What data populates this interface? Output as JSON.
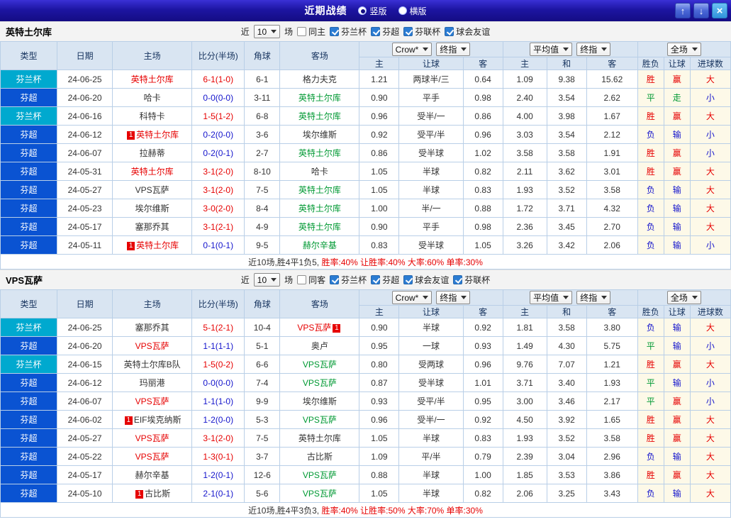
{
  "palette": {
    "cup_bg": "#00a9cf",
    "league_bg": "#0a53d2",
    "red": "#e60000",
    "green": "#009933",
    "blue": "#1414cc",
    "black": "#333333",
    "header_bg": "#d9e5f2",
    "result_bg": "#fdf9e8",
    "topbar_bg": "#1d15a2"
  },
  "topbar": {
    "title": "近期战绩",
    "vertical_label": "竖版",
    "horizontal_label": "横版",
    "up_icon": "↑",
    "down_icon": "↓",
    "close_icon": "×"
  },
  "columns": {
    "type": "类型",
    "date": "日期",
    "home": "主场",
    "score": "比分(半场)",
    "corner": "角球",
    "away": "客场",
    "asia_bookmaker": "Crow*",
    "asia_stage": "终指",
    "asia_home": "主",
    "asia_handicap": "让球",
    "asia_away": "客",
    "euro_avg": "平均值",
    "euro_stage": "终指",
    "euro_home": "主",
    "euro_draw": "和",
    "euro_away": "客",
    "result_scope": "全场",
    "result_wdl": "胜负",
    "result_handicap": "让球",
    "result_goals": "进球数"
  },
  "sections": [
    {
      "team": "英特土尔库",
      "filter": {
        "near_label": "近",
        "match_count": "10",
        "games_label": "场",
        "same_label": "同主",
        "same_checked": false,
        "leagues": [
          {
            "label": "芬兰杯",
            "checked": true
          },
          {
            "label": "芬超",
            "checked": true
          },
          {
            "label": "芬联杯",
            "checked": true
          },
          {
            "label": "球会友谊",
            "checked": true
          }
        ]
      },
      "summary_prefix": "近10场,胜4平1负5,",
      "summary_stats": "胜率:40% 让胜率:40% 大率:60% 单率:30%",
      "rows": [
        {
          "league": "芬兰杯",
          "cup": true,
          "date": "24-06-25",
          "home": {
            "name": "英特土尔库",
            "color": "red"
          },
          "score": {
            "text": "6-1(1-0)",
            "color": "red"
          },
          "corner": "6-1",
          "away": {
            "name": "格力夫克",
            "color": "black"
          },
          "asia": [
            "1.21",
            "两球半/三",
            "0.64"
          ],
          "euro": [
            "1.09",
            "9.38",
            "15.62"
          ],
          "result": [
            [
              "胜",
              "red"
            ],
            [
              "赢",
              "red"
            ],
            [
              "大",
              "red"
            ]
          ]
        },
        {
          "league": "芬超",
          "cup": false,
          "date": "24-06-20",
          "home": {
            "name": "哈卡",
            "color": "black"
          },
          "score": {
            "text": "0-0(0-0)",
            "color": "blue"
          },
          "corner": "3-11",
          "away": {
            "name": "英特土尔库",
            "color": "green"
          },
          "asia": [
            "0.90",
            "平手",
            "0.98"
          ],
          "euro": [
            "2.40",
            "3.54",
            "2.62"
          ],
          "result": [
            [
              "平",
              "green"
            ],
            [
              "走",
              "green"
            ],
            [
              "小",
              "blue"
            ]
          ]
        },
        {
          "league": "芬兰杯",
          "cup": true,
          "date": "24-06-16",
          "home": {
            "name": "科特卡",
            "color": "black"
          },
          "score": {
            "text": "1-5(1-2)",
            "color": "red"
          },
          "corner": "6-8",
          "away": {
            "name": "英特土尔库",
            "color": "green"
          },
          "asia": [
            "0.96",
            "受半/一",
            "0.86"
          ],
          "euro": [
            "4.00",
            "3.98",
            "1.67"
          ],
          "result": [
            [
              "胜",
              "red"
            ],
            [
              "赢",
              "red"
            ],
            [
              "大",
              "red"
            ]
          ]
        },
        {
          "league": "芬超",
          "cup": false,
          "date": "24-06-12",
          "home": {
            "name": "英特土尔库",
            "color": "red",
            "badge": "1"
          },
          "score": {
            "text": "0-2(0-0)",
            "color": "blue"
          },
          "corner": "3-6",
          "away": {
            "name": "埃尔维斯",
            "color": "black"
          },
          "asia": [
            "0.92",
            "受平/半",
            "0.96"
          ],
          "euro": [
            "3.03",
            "3.54",
            "2.12"
          ],
          "result": [
            [
              "负",
              "blue"
            ],
            [
              "输",
              "blue"
            ],
            [
              "小",
              "blue"
            ]
          ]
        },
        {
          "league": "芬超",
          "cup": false,
          "date": "24-06-07",
          "home": {
            "name": "拉赫蒂",
            "color": "black"
          },
          "score": {
            "text": "0-2(0-1)",
            "color": "blue"
          },
          "corner": "2-7",
          "away": {
            "name": "英特土尔库",
            "color": "green"
          },
          "asia": [
            "0.86",
            "受半球",
            "1.02"
          ],
          "euro": [
            "3.58",
            "3.58",
            "1.91"
          ],
          "result": [
            [
              "胜",
              "red"
            ],
            [
              "赢",
              "red"
            ],
            [
              "小",
              "blue"
            ]
          ]
        },
        {
          "league": "芬超",
          "cup": false,
          "date": "24-05-31",
          "home": {
            "name": "英特土尔库",
            "color": "red"
          },
          "score": {
            "text": "3-1(2-0)",
            "color": "red"
          },
          "corner": "8-10",
          "away": {
            "name": "哈卡",
            "color": "black"
          },
          "asia": [
            "1.05",
            "半球",
            "0.82"
          ],
          "euro": [
            "2.11",
            "3.62",
            "3.01"
          ],
          "result": [
            [
              "胜",
              "red"
            ],
            [
              "赢",
              "red"
            ],
            [
              "大",
              "red"
            ]
          ]
        },
        {
          "league": "芬超",
          "cup": false,
          "date": "24-05-27",
          "home": {
            "name": "VPS瓦萨",
            "color": "black"
          },
          "score": {
            "text": "3-1(2-0)",
            "color": "red"
          },
          "corner": "7-5",
          "away": {
            "name": "英特土尔库",
            "color": "green"
          },
          "asia": [
            "1.05",
            "半球",
            "0.83"
          ],
          "euro": [
            "1.93",
            "3.52",
            "3.58"
          ],
          "result": [
            [
              "负",
              "blue"
            ],
            [
              "输",
              "blue"
            ],
            [
              "大",
              "red"
            ]
          ]
        },
        {
          "league": "芬超",
          "cup": false,
          "date": "24-05-23",
          "home": {
            "name": "埃尔维斯",
            "color": "black"
          },
          "score": {
            "text": "3-0(2-0)",
            "color": "red"
          },
          "corner": "8-4",
          "away": {
            "name": "英特土尔库",
            "color": "green"
          },
          "asia": [
            "1.00",
            "半/一",
            "0.88"
          ],
          "euro": [
            "1.72",
            "3.71",
            "4.32"
          ],
          "result": [
            [
              "负",
              "blue"
            ],
            [
              "输",
              "blue"
            ],
            [
              "大",
              "red"
            ]
          ]
        },
        {
          "league": "芬超",
          "cup": false,
          "date": "24-05-17",
          "home": {
            "name": "塞那乔其",
            "color": "black"
          },
          "score": {
            "text": "3-1(2-1)",
            "color": "red"
          },
          "corner": "4-9",
          "away": {
            "name": "英特土尔库",
            "color": "green"
          },
          "asia": [
            "0.90",
            "平手",
            "0.98"
          ],
          "euro": [
            "2.36",
            "3.45",
            "2.70"
          ],
          "result": [
            [
              "负",
              "blue"
            ],
            [
              "输",
              "blue"
            ],
            [
              "大",
              "red"
            ]
          ]
        },
        {
          "league": "芬超",
          "cup": false,
          "date": "24-05-11",
          "home": {
            "name": "英特土尔库",
            "color": "red",
            "badge": "1"
          },
          "score": {
            "text": "0-1(0-1)",
            "color": "blue"
          },
          "corner": "9-5",
          "away": {
            "name": "赫尔辛基",
            "color": "green"
          },
          "asia": [
            "0.83",
            "受半球",
            "1.05"
          ],
          "euro": [
            "3.26",
            "3.42",
            "2.06"
          ],
          "result": [
            [
              "负",
              "blue"
            ],
            [
              "输",
              "blue"
            ],
            [
              "小",
              "blue"
            ]
          ]
        }
      ]
    },
    {
      "team": "VPS瓦萨",
      "filter": {
        "near_label": "近",
        "match_count": "10",
        "games_label": "场",
        "same_label": "同客",
        "same_checked": false,
        "leagues": [
          {
            "label": "芬兰杯",
            "checked": true
          },
          {
            "label": "芬超",
            "checked": true
          },
          {
            "label": "球会友谊",
            "checked": true
          },
          {
            "label": "芬联杯",
            "checked": true
          }
        ]
      },
      "summary_prefix": "近10场,胜4平3负3,",
      "summary_stats": "胜率:40% 让胜率:50% 大率:70% 单率:30%",
      "rows": [
        {
          "league": "芬兰杯",
          "cup": true,
          "date": "24-06-25",
          "home": {
            "name": "塞那乔其",
            "color": "black"
          },
          "score": {
            "text": "5-1(2-1)",
            "color": "red"
          },
          "corner": "10-4",
          "away": {
            "name": "VPS瓦萨",
            "color": "red",
            "badge": "1"
          },
          "asia": [
            "0.90",
            "半球",
            "0.92"
          ],
          "euro": [
            "1.81",
            "3.58",
            "3.80"
          ],
          "result": [
            [
              "负",
              "blue"
            ],
            [
              "输",
              "blue"
            ],
            [
              "大",
              "red"
            ]
          ]
        },
        {
          "league": "芬超",
          "cup": false,
          "date": "24-06-20",
          "home": {
            "name": "VPS瓦萨",
            "color": "red"
          },
          "score": {
            "text": "1-1(1-1)",
            "color": "blue"
          },
          "corner": "5-1",
          "away": {
            "name": "奥卢",
            "color": "black"
          },
          "asia": [
            "0.95",
            "一球",
            "0.93"
          ],
          "euro": [
            "1.49",
            "4.30",
            "5.75"
          ],
          "result": [
            [
              "平",
              "green"
            ],
            [
              "输",
              "blue"
            ],
            [
              "小",
              "blue"
            ]
          ]
        },
        {
          "league": "芬兰杯",
          "cup": true,
          "date": "24-06-15",
          "home": {
            "name": "英特土尔库B队",
            "color": "black"
          },
          "score": {
            "text": "1-5(0-2)",
            "color": "red"
          },
          "corner": "6-6",
          "away": {
            "name": "VPS瓦萨",
            "color": "green"
          },
          "asia": [
            "0.80",
            "受两球",
            "0.96"
          ],
          "euro": [
            "9.76",
            "7.07",
            "1.21"
          ],
          "result": [
            [
              "胜",
              "red"
            ],
            [
              "赢",
              "red"
            ],
            [
              "大",
              "red"
            ]
          ]
        },
        {
          "league": "芬超",
          "cup": false,
          "date": "24-06-12",
          "home": {
            "name": "玛丽港",
            "color": "black"
          },
          "score": {
            "text": "0-0(0-0)",
            "color": "blue"
          },
          "corner": "7-4",
          "away": {
            "name": "VPS瓦萨",
            "color": "green"
          },
          "asia": [
            "0.87",
            "受半球",
            "1.01"
          ],
          "euro": [
            "3.71",
            "3.40",
            "1.93"
          ],
          "result": [
            [
              "平",
              "green"
            ],
            [
              "输",
              "blue"
            ],
            [
              "小",
              "blue"
            ]
          ]
        },
        {
          "league": "芬超",
          "cup": false,
          "date": "24-06-07",
          "home": {
            "name": "VPS瓦萨",
            "color": "red"
          },
          "score": {
            "text": "1-1(1-0)",
            "color": "blue"
          },
          "corner": "9-9",
          "away": {
            "name": "埃尔维斯",
            "color": "black"
          },
          "asia": [
            "0.93",
            "受平/半",
            "0.95"
          ],
          "euro": [
            "3.00",
            "3.46",
            "2.17"
          ],
          "result": [
            [
              "平",
              "green"
            ],
            [
              "赢",
              "red"
            ],
            [
              "小",
              "blue"
            ]
          ]
        },
        {
          "league": "芬超",
          "cup": false,
          "date": "24-06-02",
          "home": {
            "name": "EIF埃克纳斯",
            "color": "black",
            "badge": "1"
          },
          "score": {
            "text": "1-2(0-0)",
            "color": "blue"
          },
          "corner": "5-3",
          "away": {
            "name": "VPS瓦萨",
            "color": "green"
          },
          "asia": [
            "0.96",
            "受半/一",
            "0.92"
          ],
          "euro": [
            "4.50",
            "3.92",
            "1.65"
          ],
          "result": [
            [
              "胜",
              "red"
            ],
            [
              "赢",
              "red"
            ],
            [
              "大",
              "red"
            ]
          ]
        },
        {
          "league": "芬超",
          "cup": false,
          "date": "24-05-27",
          "home": {
            "name": "VPS瓦萨",
            "color": "red"
          },
          "score": {
            "text": "3-1(2-0)",
            "color": "red"
          },
          "corner": "7-5",
          "away": {
            "name": "英特土尔库",
            "color": "black"
          },
          "asia": [
            "1.05",
            "半球",
            "0.83"
          ],
          "euro": [
            "1.93",
            "3.52",
            "3.58"
          ],
          "result": [
            [
              "胜",
              "red"
            ],
            [
              "赢",
              "red"
            ],
            [
              "大",
              "red"
            ]
          ]
        },
        {
          "league": "芬超",
          "cup": false,
          "date": "24-05-22",
          "home": {
            "name": "VPS瓦萨",
            "color": "red"
          },
          "score": {
            "text": "1-3(0-1)",
            "color": "red"
          },
          "corner": "3-7",
          "away": {
            "name": "古比斯",
            "color": "black"
          },
          "asia": [
            "1.09",
            "平/半",
            "0.79"
          ],
          "euro": [
            "2.39",
            "3.04",
            "2.96"
          ],
          "result": [
            [
              "负",
              "blue"
            ],
            [
              "输",
              "blue"
            ],
            [
              "大",
              "red"
            ]
          ]
        },
        {
          "league": "芬超",
          "cup": false,
          "date": "24-05-17",
          "home": {
            "name": "赫尔辛基",
            "color": "black"
          },
          "score": {
            "text": "1-2(0-1)",
            "color": "blue"
          },
          "corner": "12-6",
          "away": {
            "name": "VPS瓦萨",
            "color": "green"
          },
          "asia": [
            "0.88",
            "半球",
            "1.00"
          ],
          "euro": [
            "1.85",
            "3.53",
            "3.86"
          ],
          "result": [
            [
              "胜",
              "red"
            ],
            [
              "赢",
              "red"
            ],
            [
              "大",
              "red"
            ]
          ]
        },
        {
          "league": "芬超",
          "cup": false,
          "date": "24-05-10",
          "home": {
            "name": "古比斯",
            "color": "black",
            "badge": "1"
          },
          "score": {
            "text": "2-1(0-1)",
            "color": "blue"
          },
          "corner": "5-6",
          "away": {
            "name": "VPS瓦萨",
            "color": "green"
          },
          "asia": [
            "1.05",
            "半球",
            "0.82"
          ],
          "euro": [
            "2.06",
            "3.25",
            "3.43"
          ],
          "result": [
            [
              "负",
              "blue"
            ],
            [
              "输",
              "blue"
            ],
            [
              "大",
              "red"
            ]
          ]
        }
      ]
    }
  ]
}
